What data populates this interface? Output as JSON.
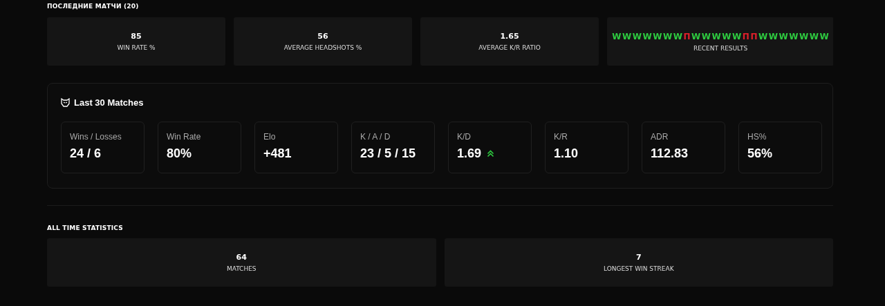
{
  "recent": {
    "title": "ПОСЛЕДНИЕ МАТЧИ (20)",
    "cards": [
      {
        "value": "85",
        "label": "WIN RATE %"
      },
      {
        "value": "56",
        "label": "AVERAGE HEADSHOTS %"
      },
      {
        "value": "1.65",
        "label": "AVERAGE K/R RATIO"
      }
    ],
    "results": {
      "label": "RECENT RESULTS",
      "items": [
        {
          "letter": "W",
          "color": "#2ecc40"
        },
        {
          "letter": "W",
          "color": "#2ecc40"
        },
        {
          "letter": "W",
          "color": "#2ecc40"
        },
        {
          "letter": "W",
          "color": "#2ecc40"
        },
        {
          "letter": "W",
          "color": "#2ecc40"
        },
        {
          "letter": "W",
          "color": "#2ecc40"
        },
        {
          "letter": "W",
          "color": "#2ecc40"
        },
        {
          "letter": "П",
          "color": "#e0202a"
        },
        {
          "letter": "W",
          "color": "#2ecc40"
        },
        {
          "letter": "W",
          "color": "#2ecc40"
        },
        {
          "letter": "W",
          "color": "#2ecc40"
        },
        {
          "letter": "W",
          "color": "#2ecc40"
        },
        {
          "letter": "W",
          "color": "#2ecc40"
        },
        {
          "letter": "П",
          "color": "#e0202a"
        },
        {
          "letter": "П",
          "color": "#e0202a"
        },
        {
          "letter": "W",
          "color": "#2ecc40"
        },
        {
          "letter": "W",
          "color": "#2ecc40"
        },
        {
          "letter": "W",
          "color": "#2ecc40"
        },
        {
          "letter": "W",
          "color": "#2ecc40"
        },
        {
          "letter": "W",
          "color": "#2ecc40"
        },
        {
          "letter": "W",
          "color": "#2ecc40"
        },
        {
          "letter": "W",
          "color": "#2ecc40"
        }
      ]
    }
  },
  "last30": {
    "title": "Last 30 Matches",
    "stats": [
      {
        "label": "Wins / Losses",
        "value": "24 / 6",
        "rising": false
      },
      {
        "label": "Win Rate",
        "value": "80%",
        "rising": false
      },
      {
        "label": "Elo",
        "value": "+481",
        "rising": false
      },
      {
        "label": "K / A / D",
        "value": "23 / 5 / 15",
        "rising": false
      },
      {
        "label": "K/D",
        "value": "1.69",
        "rising": true
      },
      {
        "label": "K/R",
        "value": "1.10",
        "rising": false
      },
      {
        "label": "ADR",
        "value": "112.83",
        "rising": false
      },
      {
        "label": "HS%",
        "value": "56%",
        "rising": false
      }
    ]
  },
  "all_time": {
    "title": "ALL TIME STATISTICS",
    "cards": [
      {
        "value": "64",
        "label": "MATCHES"
      },
      {
        "value": "7",
        "label": "LONGEST WIN STREAK"
      }
    ]
  }
}
